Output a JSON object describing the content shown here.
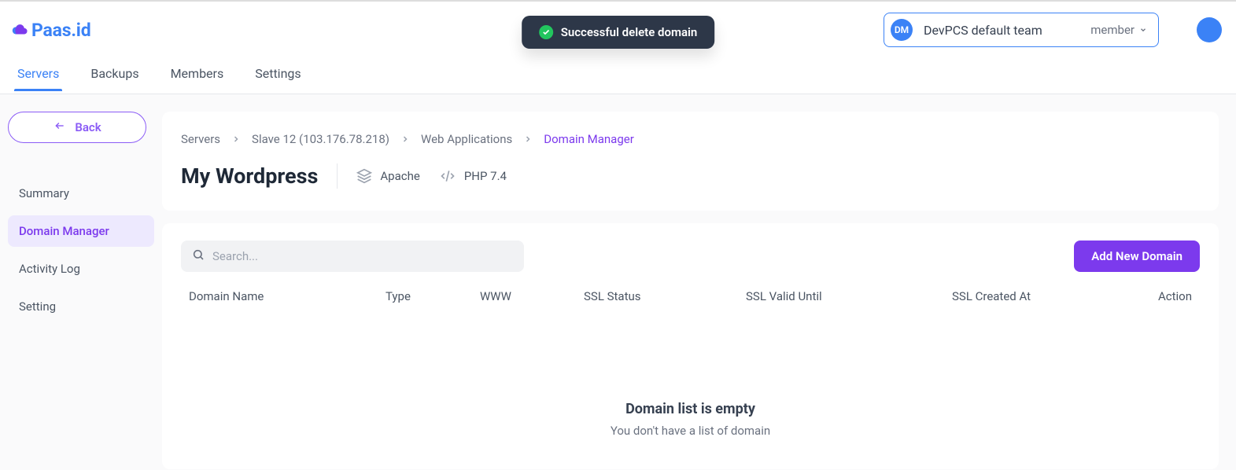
{
  "logo_text": "Paas.id",
  "toast": {
    "message": "Successful delete domain"
  },
  "team": {
    "badge": "DM",
    "name": "DevPCS default team",
    "role": "member"
  },
  "tabs": [
    "Servers",
    "Backups",
    "Members",
    "Settings"
  ],
  "back_label": "Back",
  "side_nav": [
    "Summary",
    "Domain Manager",
    "Activity Log",
    "Setting"
  ],
  "breadcrumbs": [
    "Servers",
    "Slave 12 (103.176.78.218)",
    "Web Applications",
    "Domain Manager"
  ],
  "page_title": "My Wordpress",
  "meta": {
    "server": "Apache",
    "php": "PHP 7.4"
  },
  "search_placeholder": "Search...",
  "add_button": "Add New Domain",
  "columns": {
    "name": "Domain Name",
    "type": "Type",
    "www": "WWW",
    "ssl_status": "SSL Status",
    "ssl_valid": "SSL Valid Until",
    "ssl_created": "SSL Created At",
    "action": "Action"
  },
  "empty": {
    "title": "Domain list is empty",
    "sub": "You don't have a list of domain"
  }
}
